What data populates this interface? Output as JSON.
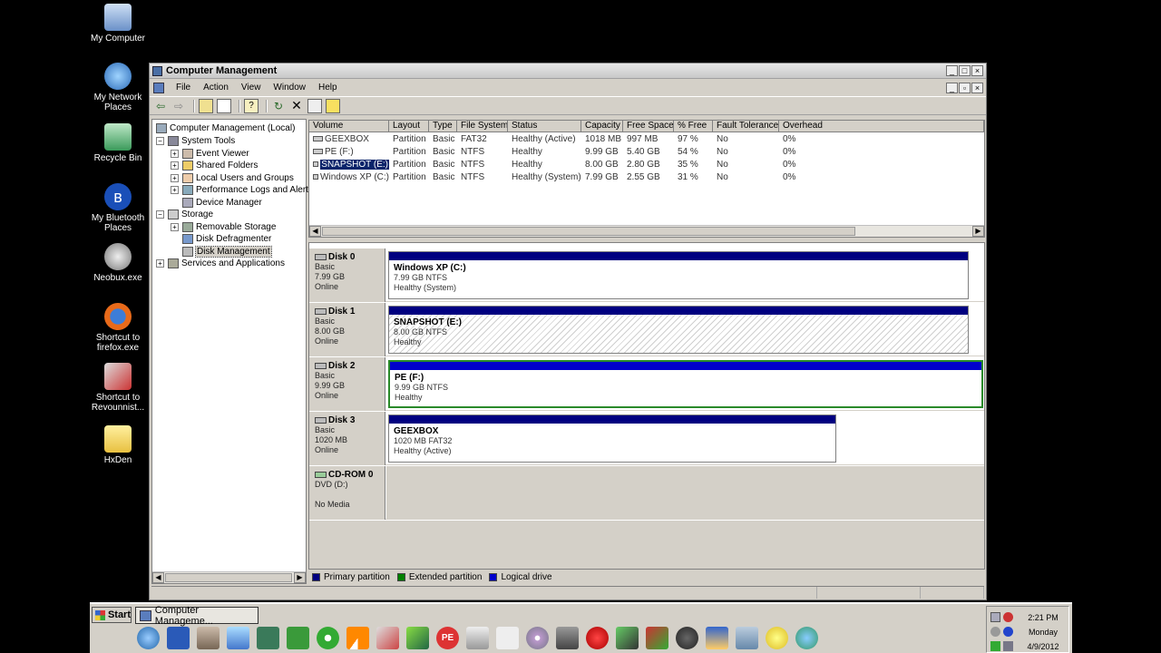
{
  "desktop_icons": [
    {
      "label": "My Computer",
      "icon": "my-computer-icon"
    },
    {
      "label": "My Network Places",
      "icon": "network-places-icon"
    },
    {
      "label": "Recycle Bin",
      "icon": "recycle-bin-icon"
    },
    {
      "label": "My Bluetooth Places",
      "icon": "bluetooth-icon"
    },
    {
      "label": "Neobux.exe",
      "icon": "neobux-icon"
    },
    {
      "label": "Shortcut to firefox.exe",
      "icon": "firefox-icon"
    },
    {
      "label": "Shortcut to Revounnist...",
      "icon": "revo-uninstaller-icon"
    },
    {
      "label": "HxDen",
      "icon": "folder-icon"
    }
  ],
  "window": {
    "title": "Computer Management",
    "menu": [
      "File",
      "Action",
      "View",
      "Window",
      "Help"
    ]
  },
  "tree": {
    "root": "Computer Management (Local)",
    "system_tools": "System Tools",
    "event_viewer": "Event Viewer",
    "shared_folders": "Shared Folders",
    "local_users": "Local Users and Groups",
    "perf_logs": "Performance Logs and Alerts",
    "device_manager": "Device Manager",
    "storage": "Storage",
    "removable_storage": "Removable Storage",
    "disk_defrag": "Disk Defragmenter",
    "disk_management": "Disk Management",
    "services": "Services and Applications"
  },
  "volume_list": {
    "columns": [
      "Volume",
      "Layout",
      "Type",
      "File System",
      "Status",
      "Capacity",
      "Free Space",
      "% Free",
      "Fault Tolerance",
      "Overhead"
    ],
    "rows": [
      [
        "GEEXBOX",
        "Partition",
        "Basic",
        "FAT32",
        "Healthy (Active)",
        "1018 MB",
        "997 MB",
        "97 %",
        "No",
        "0%"
      ],
      [
        "PE (F:)",
        "Partition",
        "Basic",
        "NTFS",
        "Healthy",
        "9.99 GB",
        "5.40 GB",
        "54 %",
        "No",
        "0%"
      ],
      [
        "SNAPSHOT (E:)",
        "Partition",
        "Basic",
        "NTFS",
        "Healthy",
        "8.00 GB",
        "2.80 GB",
        "35 %",
        "No",
        "0%"
      ],
      [
        "Windows XP (C:)",
        "Partition",
        "Basic",
        "NTFS",
        "Healthy (System)",
        "7.99 GB",
        "2.55 GB",
        "31 %",
        "No",
        "0%"
      ]
    ]
  },
  "disks": [
    {
      "name": "Disk 0",
      "type": "Basic",
      "size": "7.99 GB",
      "state": "Online",
      "part_name": "Windows XP  (C:)",
      "part_size": "7.99 GB NTFS",
      "part_status": "Healthy (System)"
    },
    {
      "name": "Disk 1",
      "type": "Basic",
      "size": "8.00 GB",
      "state": "Online",
      "part_name": "SNAPSHOT  (E:)",
      "part_size": "8.00 GB NTFS",
      "part_status": "Healthy"
    },
    {
      "name": "Disk 2",
      "type": "Basic",
      "size": "9.99 GB",
      "state": "Online",
      "part_name": "PE  (F:)",
      "part_size": "9.99 GB NTFS",
      "part_status": "Healthy"
    },
    {
      "name": "Disk 3",
      "type": "Basic",
      "size": "1020 MB",
      "state": "Online",
      "part_name": "GEEXBOX",
      "part_size": "1020 MB FAT32",
      "part_status": "Healthy (Active)"
    }
  ],
  "cdrom": {
    "name": "CD-ROM 0",
    "drive": "DVD (D:)",
    "media": "No Media"
  },
  "legend": {
    "primary": "Primary partition",
    "extended": "Extended partition",
    "logical": "Logical drive",
    "colors": {
      "primary": "#000080",
      "extended": "#008000",
      "logical": "#0000cc"
    }
  },
  "taskbar": {
    "start": "Start",
    "task": "Computer Manageme...",
    "clock_time": "2:21 PM",
    "clock_day": "Monday",
    "clock_date": "4/9/2012"
  }
}
